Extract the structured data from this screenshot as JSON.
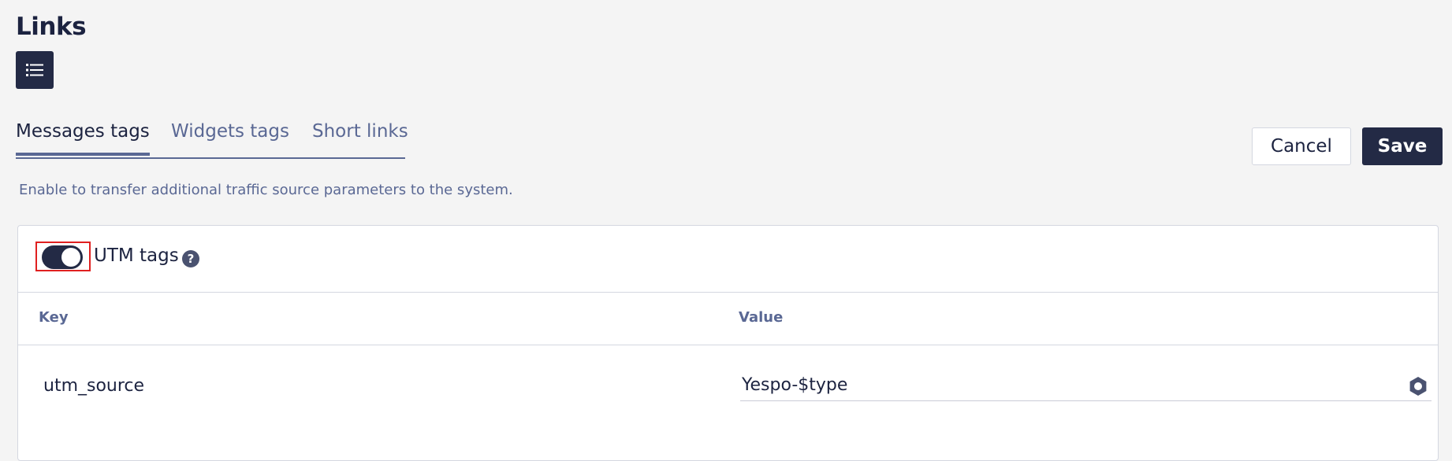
{
  "page": {
    "title": "Links"
  },
  "icons": {
    "list_view": "list-icon",
    "help": "question-circle-icon",
    "settings": "gear-icon"
  },
  "tabs": [
    {
      "label": "Messages tags",
      "active": true
    },
    {
      "label": "Widgets tags",
      "active": false
    },
    {
      "label": "Short links",
      "active": false
    }
  ],
  "actions": {
    "cancel_label": "Cancel",
    "save_label": "Save"
  },
  "description": "Enable to transfer additional traffic source parameters to the system.",
  "utm": {
    "label": "UTM tags",
    "enabled": true,
    "help_glyph": "?"
  },
  "table": {
    "columns": [
      "Key",
      "Value"
    ],
    "rows": [
      {
        "key": "utm_source",
        "value": "Yespo-$type"
      }
    ]
  },
  "colors": {
    "primary": "#232a45",
    "accent": "#5a6894",
    "highlight": "#e02020",
    "background": "#f4f4f4"
  }
}
